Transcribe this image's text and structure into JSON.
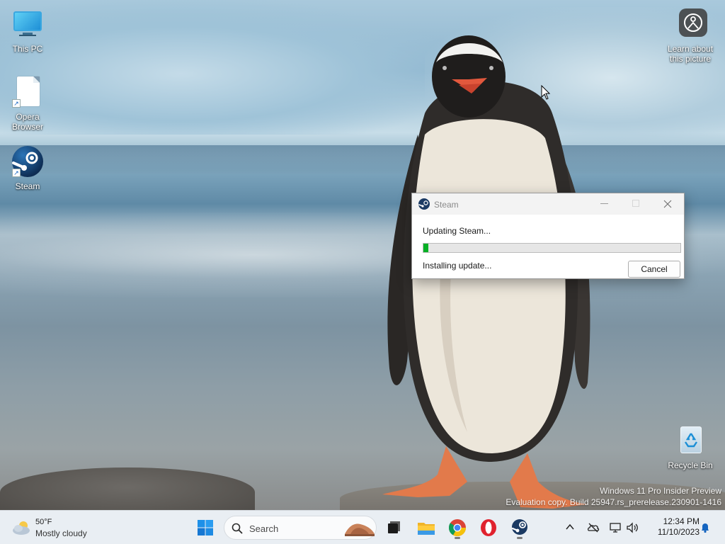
{
  "desktop": {
    "icons": [
      {
        "label": "This PC",
        "icon": "monitor-icon"
      },
      {
        "label": "Opera Browser",
        "icon": "file-icon"
      },
      {
        "label": "Steam",
        "icon": "steam-icon"
      },
      {
        "label": "Learn about this picture",
        "icon": "camera-icon"
      },
      {
        "label": "Recycle Bin",
        "icon": "recycle-bin-icon"
      }
    ],
    "watermark": {
      "line1": "Windows 11 Pro Insider Preview",
      "line2": "Evaluation copy. Build 25947.rs_prerelease.230901-1416"
    }
  },
  "dialog": {
    "title": "Steam",
    "status": "Updating Steam...",
    "progress_fraction": 0.02,
    "detail": "Installing update...",
    "cancel_label": "Cancel"
  },
  "taskbar": {
    "weather": {
      "temperature": "50°F",
      "condition": "Mostly cloudy"
    },
    "search_label": "Search",
    "apps": [
      "start-icon",
      "task-view-icon",
      "file-explorer-icon",
      "chrome-icon",
      "opera-icon",
      "steam-icon"
    ],
    "tray": [
      "chevron-up-icon",
      "onedrive-icon",
      "network-icon",
      "speaker-icon"
    ],
    "time": "12:34 PM",
    "date": "11/10/2023"
  },
  "colors": {
    "progress_green": "#06b025",
    "taskbar_bg": "#e9eef3",
    "steam_blue": "#1b3a63"
  }
}
